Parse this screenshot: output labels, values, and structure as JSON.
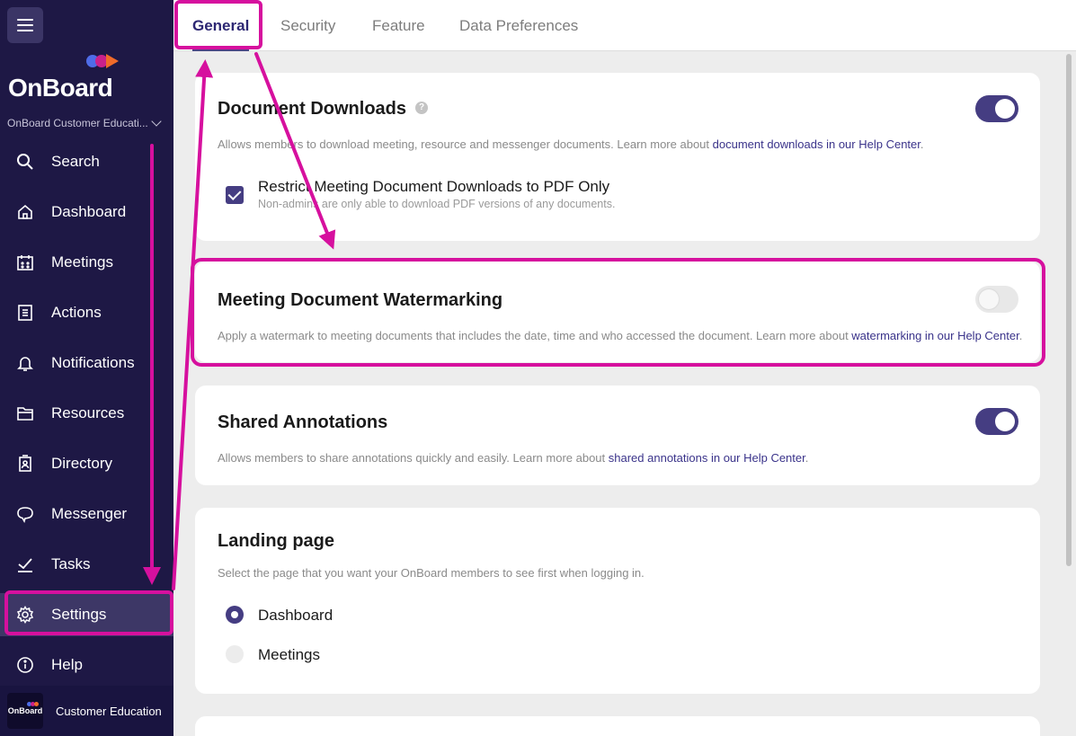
{
  "sidebar": {
    "brand": "OnBoard",
    "org_name": "OnBoard Customer Educati...",
    "items": [
      {
        "label": "Search",
        "icon": "search-icon"
      },
      {
        "label": "Dashboard",
        "icon": "home-icon"
      },
      {
        "label": "Meetings",
        "icon": "calendar-icon"
      },
      {
        "label": "Actions",
        "icon": "clipboard-icon"
      },
      {
        "label": "Notifications",
        "icon": "bell-icon"
      },
      {
        "label": "Resources",
        "icon": "folder-icon"
      },
      {
        "label": "Directory",
        "icon": "contact-book-icon"
      },
      {
        "label": "Messenger",
        "icon": "chat-bubble-icon"
      },
      {
        "label": "Tasks",
        "icon": "checkmark-icon"
      },
      {
        "label": "Settings",
        "icon": "gear-icon",
        "active": true
      },
      {
        "label": "Help",
        "icon": "info-icon"
      }
    ],
    "account": {
      "logo_text": "OnBoard",
      "name": "Customer Education"
    }
  },
  "tabs": [
    {
      "label": "General",
      "active": true
    },
    {
      "label": "Security"
    },
    {
      "label": "Feature"
    },
    {
      "label": "Data Preferences"
    }
  ],
  "cards": {
    "downloads": {
      "title": "Document Downloads",
      "help_glyph": "?",
      "enabled": true,
      "description": "Allows members to download meeting, resource and messenger documents. Learn more about ",
      "link": "document downloads in our Help Center",
      "link_suffix": ".",
      "option": {
        "label": "Restrict Meeting Document Downloads to PDF Only",
        "sub": "Non-admins are only able to download PDF versions of any documents.",
        "checked": true
      }
    },
    "watermark": {
      "title": "Meeting Document Watermarking",
      "enabled": false,
      "description": "Apply a watermark to meeting documents that includes the date, time and who accessed the document. Learn more about ",
      "link": "watermarking in our Help Center",
      "link_suffix": "."
    },
    "annotations": {
      "title": "Shared Annotations",
      "enabled": true,
      "description": "Allows members to share annotations quickly and easily. Learn more about ",
      "link": "shared annotations in our Help Center",
      "link_suffix": "."
    },
    "landing": {
      "title": "Landing page",
      "description": "Select the page that you want your OnBoard members to see first when logging in.",
      "options": [
        {
          "label": "Dashboard",
          "selected": true
        },
        {
          "label": "Meetings",
          "selected": false
        }
      ]
    }
  },
  "colors": {
    "sidebar_bg": "#1e1845",
    "accent": "#453d82",
    "highlight": "#d6109e",
    "logo_dots": [
      "#4f6ce8",
      "#c9218b",
      "#f06b2a"
    ]
  }
}
